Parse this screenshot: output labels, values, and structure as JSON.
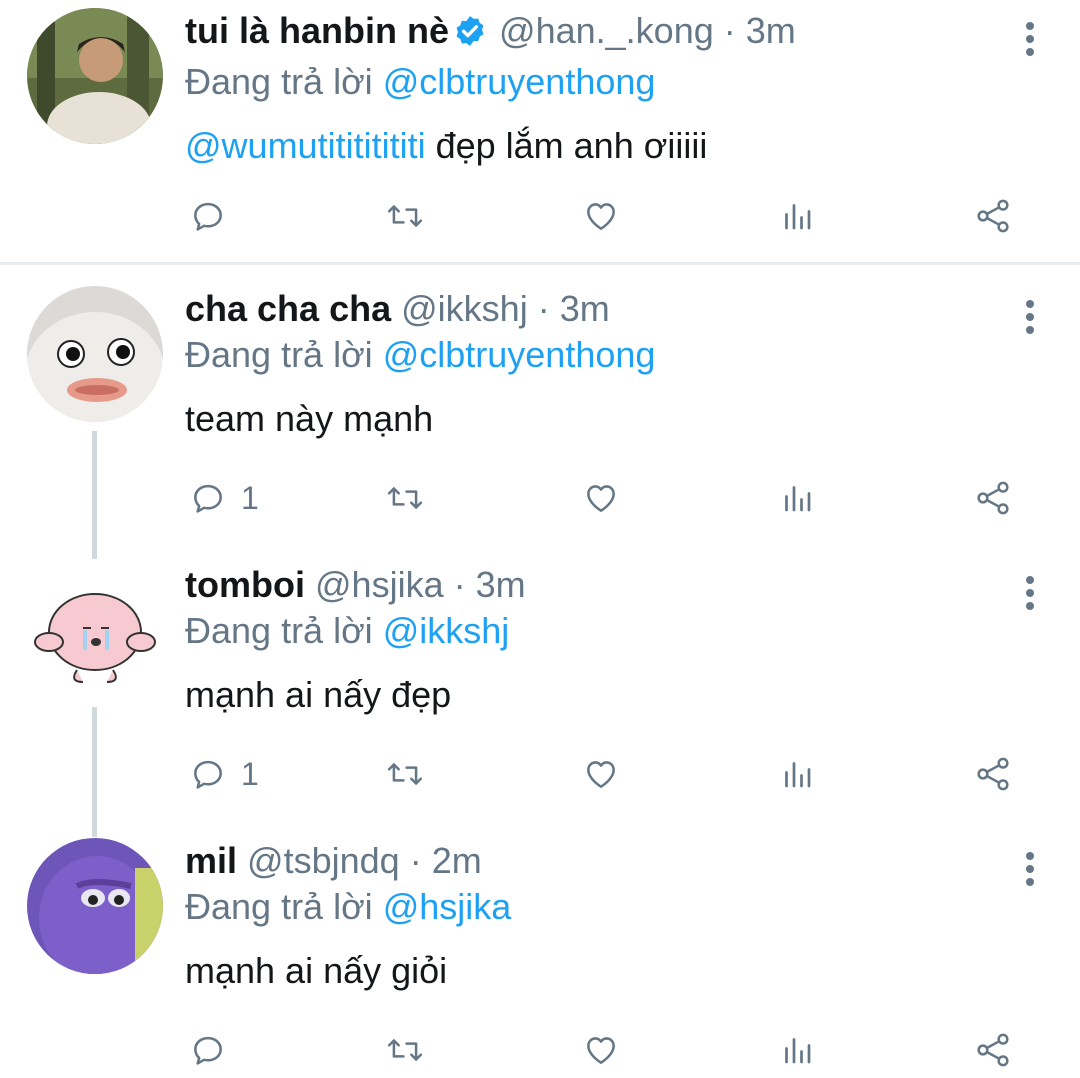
{
  "replying_prefix": "Đang trả lời",
  "dot": "·",
  "colors": {
    "accent": "#1da1f2",
    "muted": "#657786",
    "text": "#14171a",
    "line": "#cfd9de"
  },
  "tweets": [
    {
      "name": "tui là hanbin nè",
      "verified": true,
      "handle": "@han._.kong",
      "time": "3m",
      "replying_to": "@clbtruyenthong",
      "mention": "@wumutitititititi",
      "text": " đẹp lắm anh ơiiiii",
      "reply_count": ""
    },
    {
      "name": "cha cha cha",
      "verified": false,
      "handle": "@ikkshj",
      "time": "3m",
      "replying_to": "@clbtruyenthong",
      "mention": "",
      "text": "team này mạnh",
      "reply_count": "1"
    },
    {
      "name": "tomboi",
      "verified": false,
      "handle": "@hsjika",
      "time": "3m",
      "replying_to": "@ikkshj",
      "mention": "",
      "text": "mạnh ai nấy đẹp",
      "reply_count": "1"
    },
    {
      "name": "mil",
      "verified": false,
      "handle": "@tsbjndq",
      "time": "2m",
      "replying_to": "@hsjika",
      "mention": "",
      "text": "mạnh ai nấy giỏi",
      "reply_count": ""
    }
  ],
  "action_icons": [
    "reply-icon",
    "retweet-icon",
    "like-icon",
    "analytics-icon",
    "share-icon"
  ]
}
